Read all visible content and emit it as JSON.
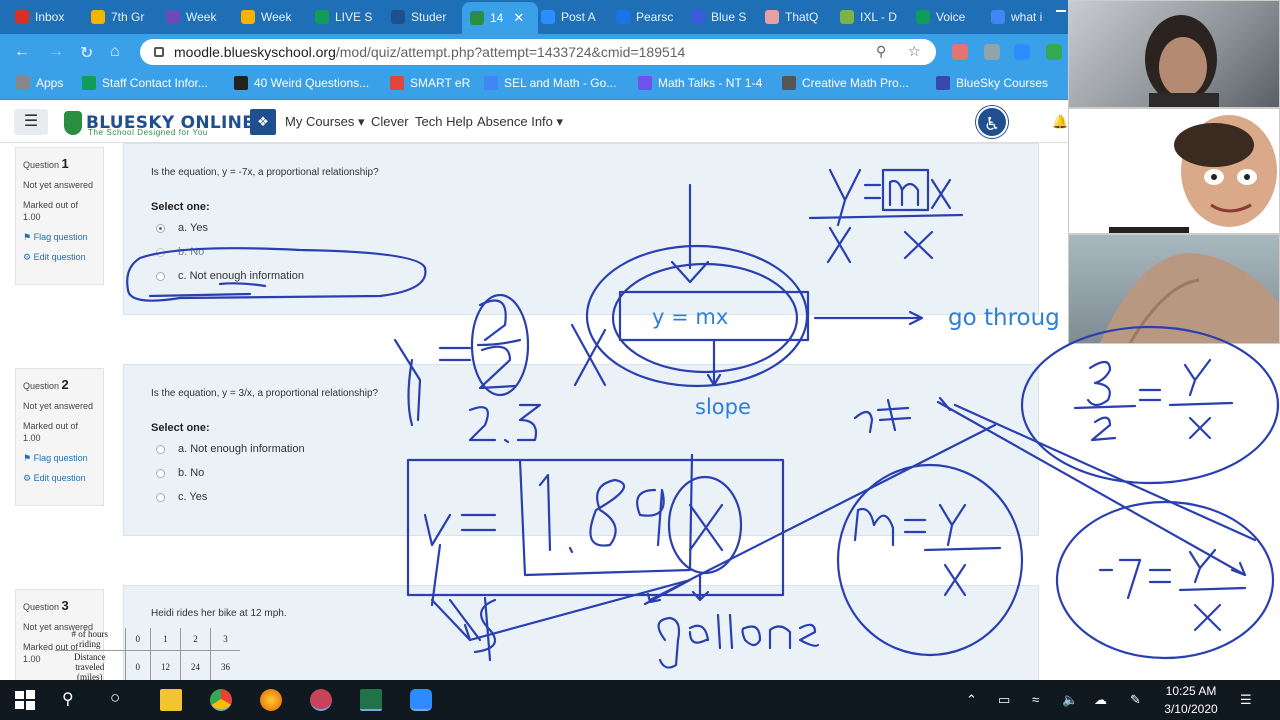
{
  "browser": {
    "tabs": [
      {
        "label": "Inbox",
        "color": "#d93025"
      },
      {
        "label": "7th Gr",
        "color": "#f4b400"
      },
      {
        "label": "Week",
        "color": "#6c4bb8"
      },
      {
        "label": "Week",
        "color": "#f4b400"
      },
      {
        "label": "LIVE S",
        "color": "#0f9d58"
      },
      {
        "label": "Studer",
        "color": "#1f4f8f"
      },
      {
        "label": "14",
        "color": "#2b8d3f",
        "active": true
      },
      {
        "label": "Post A",
        "color": "#2d8cff"
      },
      {
        "label": "Pearsc",
        "color": "#1a73e8"
      },
      {
        "label": "Blue S",
        "color": "#3b5bdb"
      },
      {
        "label": "ThatQ",
        "color": "#e8a0a0"
      },
      {
        "label": "IXL - D",
        "color": "#7cb342"
      },
      {
        "label": "Voice",
        "color": "#0f9d58"
      },
      {
        "label": "what i",
        "color": "#4285f4"
      }
    ],
    "url_host": "moodle.blueskyschool.org",
    "url_path": "/mod/quiz/attempt.php?attempt=1433724&cmid=189514",
    "bookmarks": [
      {
        "label": "Apps",
        "color": "#888"
      },
      {
        "label": "Staff Contact Infor...",
        "color": "#0f9d58"
      },
      {
        "label": "40 Weird Questions...",
        "color": "#222"
      },
      {
        "label": "SMART eR",
        "color": "#e0463b"
      },
      {
        "label": "SEL and Math - Go...",
        "color": "#4285f4"
      },
      {
        "label": "Math Talks - NT 1-4",
        "color": "#6f52ed"
      },
      {
        "label": "Creative Math Pro...",
        "color": "#555"
      },
      {
        "label": "BlueSky Courses",
        "color": "#3949ab"
      }
    ]
  },
  "site": {
    "brand": "BLUESKY ONLINE",
    "tagline": "The School Designed for You",
    "menu": [
      {
        "label": "My Courses",
        "dropdown": true
      },
      {
        "label": "Clever",
        "dropdown": false
      },
      {
        "label": "Tech Help",
        "dropdown": false
      },
      {
        "label": "Absence Info",
        "dropdown": true
      }
    ]
  },
  "quiz": {
    "select_label": "Select one:",
    "questions": [
      {
        "label": "Question",
        "number": "1",
        "status": "Not yet answered",
        "marked": "Marked out of",
        "marks": "1.00",
        "flag": "Flag question",
        "edit": "Edit question",
        "text": "Is the equation, y = -7x, a proportional relationship?",
        "options": [
          "a. Yes",
          "b. No",
          "c. Not enough information"
        ],
        "selected": 0
      },
      {
        "label": "Question",
        "number": "2",
        "status": "Not yet answered",
        "marked": "Marked out of",
        "marks": "1.00",
        "flag": "Flag question",
        "edit": "Edit question",
        "text": "Is the equation, y = 3/x, a proportional relationship?",
        "options": [
          "a. Not enough information",
          "b. No",
          "c. Yes"
        ],
        "selected": -1
      },
      {
        "label": "Question",
        "number": "3",
        "status": "Not yet answered",
        "marked": "Marked out of",
        "marks": "1.00",
        "text": "Heidi rides her bike at 12 mph.",
        "table": {
          "rows": [
            {
              "header": "# of hours riding",
              "values": [
                "0",
                "1",
                "2",
                "3"
              ]
            },
            {
              "header": "Distance traveled (miles)",
              "values": [
                "0",
                "12",
                "24",
                "36"
              ]
            }
          ]
        }
      }
    ]
  },
  "annotations": {
    "center_equation": "y = mx",
    "center_label": "slope",
    "right_text": "go throug"
  },
  "taskbar": {
    "time": "10:25 AM",
    "date": "3/10/2020"
  }
}
